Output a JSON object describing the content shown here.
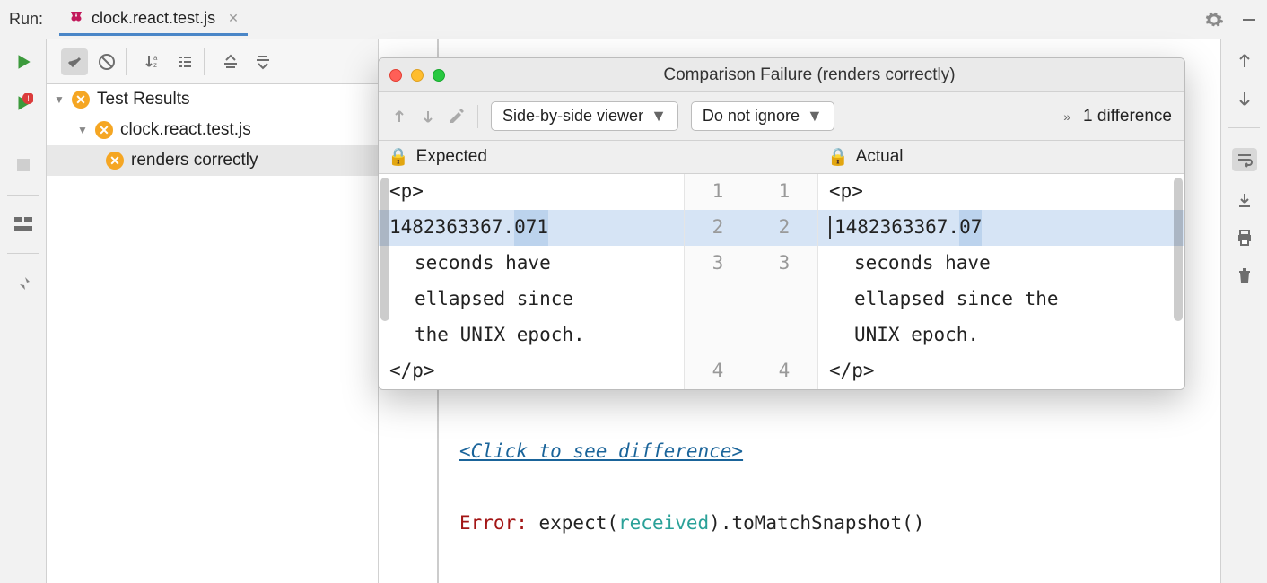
{
  "header": {
    "run_label": "Run:",
    "tab_label": "clock.react.test.js"
  },
  "tree": {
    "root_label": "Test Results",
    "file_label": "clock.react.test.js",
    "test_label": "renders correctly"
  },
  "console": {
    "link": "<Click to see difference>",
    "error_prefix": "Error:",
    "error_expect": " expect(",
    "error_received": "received",
    "error_tail": ").toMatchSnapshot()"
  },
  "dialog": {
    "title": "Comparison Failure (renders correctly)",
    "viewer_mode": "Side-by-side viewer",
    "ignore_mode": "Do not ignore",
    "diff_count": "1 difference",
    "expected_label": "Expected",
    "actual_label": "Actual",
    "expected_lines": {
      "l1": "<p>",
      "l2_pre": "  1482363367.",
      "l2_hl": "071",
      "l3a": "   seconds have",
      "l3b": "  ellapsed since",
      "l3c": "  the UNIX epoch.",
      "l4": "</p>"
    },
    "actual_lines": {
      "l1": "<p>",
      "l2_pre": "  1482363367.",
      "l2_hl": "07",
      "l3a": "   seconds have",
      "l3b": "  ellapsed since the",
      "l3c": "  UNIX epoch.",
      "l4": "</p>"
    },
    "nums": {
      "n1": "1",
      "n2": "2",
      "n3": "3",
      "n4": "4"
    }
  }
}
